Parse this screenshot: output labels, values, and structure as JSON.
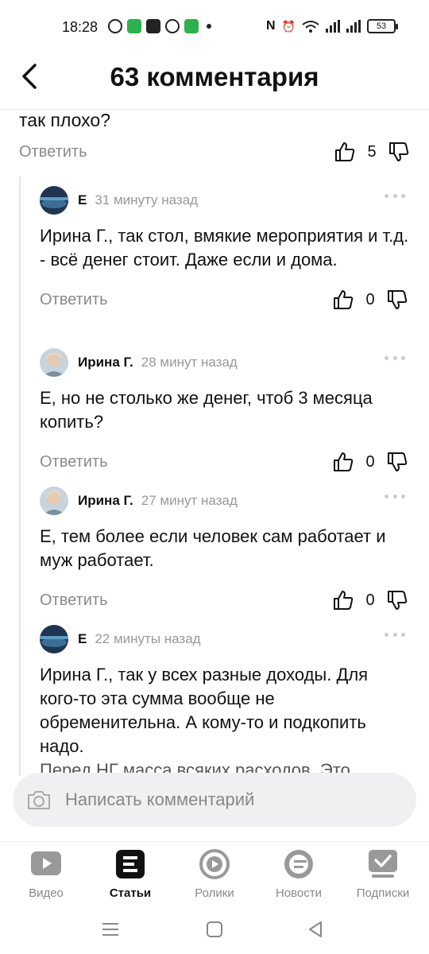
{
  "status_bar": {
    "time": "18:28",
    "battery": "53",
    "left_icons": [
      "whatsapp-icon",
      "app-icon",
      "app-icon",
      "check-circle-icon",
      "message-icon"
    ],
    "right_icons": [
      "nfc-icon",
      "alarm-icon",
      "wifi-icon",
      "signal-icon",
      "signal-icon",
      "battery-icon"
    ]
  },
  "header": {
    "title": "63 комментария",
    "back_icon": "chevron-left-icon"
  },
  "previous_comment": {
    "text_tail": "так плохо?",
    "reply_label": "Ответить",
    "likes": "5"
  },
  "comments": [
    {
      "author": "Е",
      "time": "31 минуту назад",
      "text": "Ирина Г., так стол, вмякие мероприятия и т.д.  - всё денег стоит. Даже если и дома.",
      "reply_label": "Ответить",
      "likes": "0"
    },
    {
      "author": "Ирина Г.",
      "time": "28 минут назад",
      "text": "Е, но не столько же денег, чтоб 3 месяца копить?",
      "reply_label": "Ответить",
      "likes": "0"
    },
    {
      "author": "Ирина Г.",
      "time": "27 минут назад",
      "text": "Е, тем более если человек сам работает и муж работает.",
      "reply_label": "Ответить",
      "likes": "0"
    },
    {
      "author": "Е",
      "time": "22 минуты назад",
      "text": "Ирина Г., так у всех разные доходы. Для кого-то эта сумма вообще не обременительна. А кому-то и подкопить надо.",
      "text_cut": "Перед НГ масса всяких расходов. Это"
    }
  ],
  "composer": {
    "placeholder": "Написать комментарий"
  },
  "bottom_nav": {
    "items": [
      {
        "label": "Видео",
        "icon": "video-icon"
      },
      {
        "label": "Статьи",
        "icon": "articles-icon",
        "active": true
      },
      {
        "label": "Ролики",
        "icon": "shorts-icon"
      },
      {
        "label": "Новости",
        "icon": "news-icon"
      },
      {
        "label": "Подписки",
        "icon": "subscriptions-icon"
      }
    ]
  },
  "colors": {
    "accent": "#111111",
    "muted": "#8a8a8a",
    "divider": "#e6e6e6",
    "composer_bg": "#f0f0f2"
  }
}
